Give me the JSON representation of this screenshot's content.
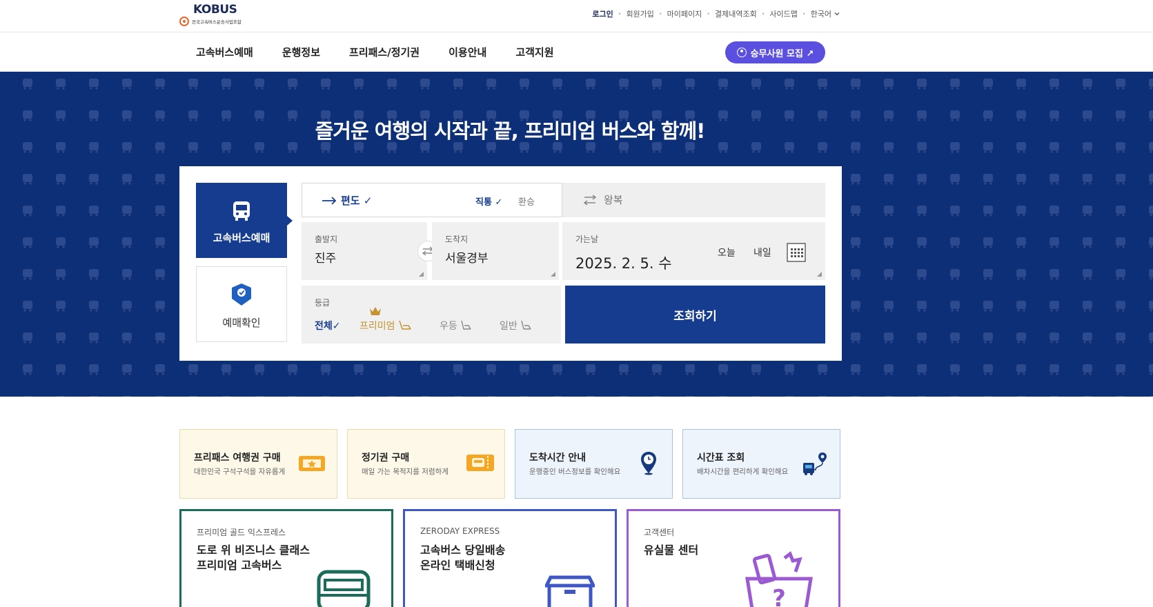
{
  "logo": {
    "brand": "KOBUS",
    "subtitle": "전국고속버스운송사업조합"
  },
  "utility_nav": {
    "login": "로그인",
    "signup": "회원가입",
    "mypage": "마이페이지",
    "payment_history": "결제내역조회",
    "sitemap": "사이드맵",
    "language": "한국어"
  },
  "gnb": {
    "items": [
      "고속버스예매",
      "운행정보",
      "프리패스/정기권",
      "이용안내",
      "고객지원"
    ],
    "recruit_button": "승무사원 모집 ↗"
  },
  "hero": {
    "title": "즐거운 여행의 시작과 끝, 프리미엄 버스와 함께!"
  },
  "booking": {
    "tabs": {
      "reserve": "고속버스예매",
      "check": "예매확인"
    },
    "trip": {
      "oneway": "편도 ✓",
      "direct": "직통 ✓",
      "transfer": "환승",
      "roundtrip": "왕복"
    },
    "departure": {
      "caption": "출발지",
      "value": "진주"
    },
    "arrival": {
      "caption": "도착지",
      "value": "서울경부"
    },
    "date": {
      "caption": "가는날",
      "value": "2025. 2. 5. 수",
      "today": "오늘",
      "tomorrow": "내일"
    },
    "grade": {
      "caption": "등급",
      "options": [
        "전체✓",
        "프리미엄",
        "우등",
        "일반"
      ],
      "selected": "전체"
    },
    "search_button": "조회하기"
  },
  "quick_links": [
    {
      "title": "프리패스 여행권 구매",
      "desc": "대한민국 구석구석을 자유롭게",
      "icon": "ticket-star-icon"
    },
    {
      "title": "정기권 구매",
      "desc": "매일 가는 목적지를 저렴하게",
      "icon": "bus-ticket-icon"
    },
    {
      "title": "도착시간 안내",
      "desc": "운행중인 버스정보를 확인해요",
      "icon": "location-clock-icon"
    },
    {
      "title": "시간표 조회",
      "desc": "배차시간을 편리하게 확인해요",
      "icon": "bus-route-icon"
    }
  ],
  "feature_cards": [
    {
      "category": "프리미엄 골드 익스프레스",
      "heading1": "도로 위 비즈니스 클래스",
      "heading2": "프리미엄 고속버스",
      "icon": "premium-bus-icon"
    },
    {
      "category": "ZERODAY EXPRESS",
      "heading1": "고속버스 당일배송",
      "heading2": "온라인 택배신청",
      "icon": "parcel-box-icon"
    },
    {
      "category": "고객센터",
      "heading1": "유실물 센터",
      "heading2": "",
      "icon": "lost-items-bag-icon"
    }
  ],
  "colors": {
    "navy": "#153c8e",
    "hero_bg": "#0d2f78",
    "purple_button": "#5b4fe0",
    "premium_gold": "#c4932d"
  }
}
